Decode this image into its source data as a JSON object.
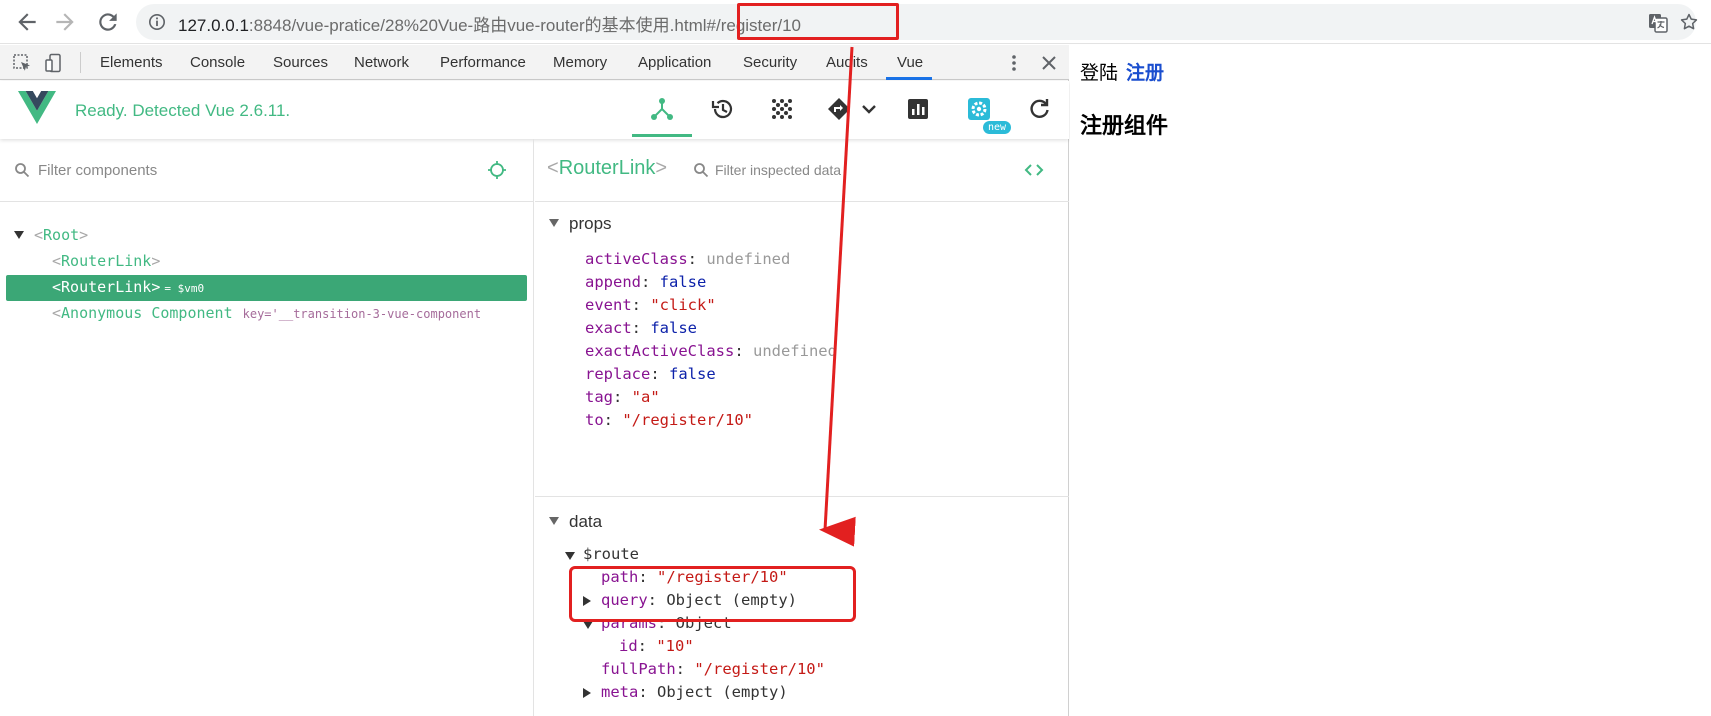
{
  "browser": {
    "url_host": "127.0.0.1",
    "url_rest": ":8848/vue-pratice/28%20Vue-路由vue-router的基本使用.html#/register/10"
  },
  "devtools": {
    "tabs": [
      "Elements",
      "Console",
      "Sources",
      "Network",
      "Performance",
      "Memory",
      "Application",
      "Security",
      "Audits",
      "Vue"
    ],
    "active_tab": "Vue"
  },
  "vue": {
    "status": "Ready. Detected Vue 2.6.11.",
    "new_badge": "new",
    "brand_color": "#42b983",
    "components": {
      "filter_placeholder": "Filter components",
      "tree": {
        "root": "Root",
        "link1": "RouterLink",
        "link2": "RouterLink",
        "link2_vm": "= $vm0",
        "anon": "Anonymous Component",
        "anon_key": "key='__transition-3-vue-component"
      }
    },
    "inspector": {
      "component": "RouterLink",
      "filter_placeholder": "Filter inspected data",
      "props_title": "props",
      "props": [
        {
          "key": "activeClass",
          "value": "undefined",
          "type": "undef"
        },
        {
          "key": "append",
          "value": "false",
          "type": "bool"
        },
        {
          "key": "event",
          "value": "\"click\"",
          "type": "str"
        },
        {
          "key": "exact",
          "value": "false",
          "type": "bool"
        },
        {
          "key": "exactActiveClass",
          "value": "undefined",
          "type": "undef"
        },
        {
          "key": "replace",
          "value": "false",
          "type": "bool"
        },
        {
          "key": "tag",
          "value": "\"a\"",
          "type": "str"
        },
        {
          "key": "to",
          "value": "\"/register/10\"",
          "type": "str"
        }
      ],
      "data_title": "data",
      "route_key": "$route",
      "route": {
        "path_key": "path",
        "path_val": "\"/register/10\"",
        "query_key": "query",
        "query_val": "Object (empty)",
        "params_key": "params",
        "params_val": "Object",
        "id_key": "id",
        "id_val": "\"10\"",
        "fullpath_key": "fullPath",
        "fullpath_val": "\"/register/10\"",
        "meta_key": "meta",
        "meta_val": "Object (empty)"
      }
    }
  },
  "app": {
    "nav_login": "登陆",
    "nav_register": "注册",
    "view_title": "注册组件"
  }
}
